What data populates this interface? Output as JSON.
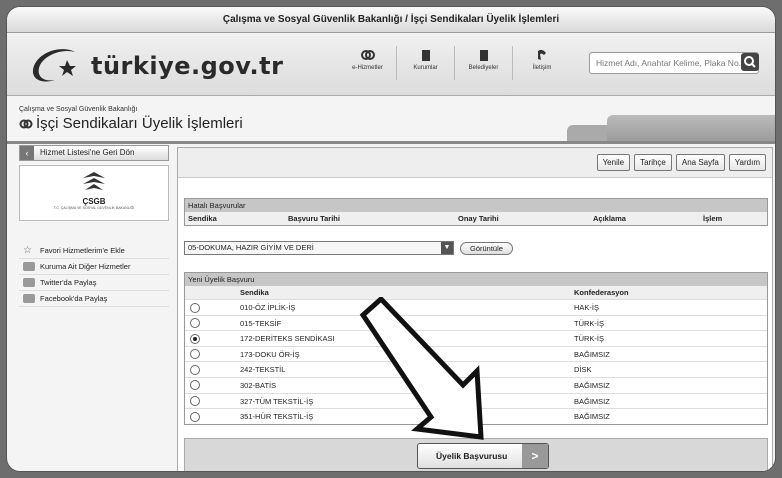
{
  "window": {
    "title": "Çalışma ve Sosyal Güvenlik Bakanlığı / İşçi Sendikaları Üyelik İşlemleri"
  },
  "header": {
    "logo_text": "türkiye.gov.tr",
    "nav": [
      {
        "label": "e-Hizmetler",
        "icon": "chain-link-icon"
      },
      {
        "label": "Kurumlar",
        "icon": "building-icon"
      },
      {
        "label": "Belediyeler",
        "icon": "municipality-icon"
      },
      {
        "label": "İletişim",
        "icon": "phone-icon"
      }
    ],
    "search_placeholder": "Hizmet Adı, Anahtar Kelime, Plaka No..."
  },
  "page": {
    "ministry": "Çalışma ve Sosyal Güvenlik Bakanlığı",
    "title": "İşçi Sendikaları Üyelik İşlemleri"
  },
  "sidebar": {
    "back_label": "Hizmet Listesi'ne Geri Dön",
    "org_abbr": "ÇSGB",
    "org_full": "T.C. ÇALIŞMA VE SOSYAL GÜVENLİK BAKANLIĞI",
    "links": [
      {
        "label": "Favori Hizmetlerim'e Ekle",
        "icon": "star-icon"
      },
      {
        "label": "Kuruma Ait Diğer Hizmetler",
        "icon": "list-icon"
      },
      {
        "label": "Twitter'da Paylaş",
        "icon": "twitter-icon"
      },
      {
        "label": "Facebook'da Paylaş",
        "icon": "facebook-icon"
      }
    ]
  },
  "toolbar": {
    "buttons": [
      "Yenile",
      "Tarihçe",
      "Ana Sayfa",
      "Yardım"
    ]
  },
  "hatali": {
    "title": "Hatalı Başvurular",
    "columns": [
      "Sendika",
      "Başvuru Tarihi",
      "Onay Tarihi",
      "Açıklama",
      "İşlem"
    ]
  },
  "filter": {
    "selected": "05-DOKUMA, HAZIR GİYİM VE DERİ",
    "button": "Görüntüle"
  },
  "yeni": {
    "title": "Yeni Üyelik Başvuru",
    "columns": [
      "",
      "Sendika",
      "Konfederasyon"
    ],
    "rows": [
      {
        "sendika": "010-ÖZ İPLİK-İŞ",
        "konf": "HAK-İŞ",
        "selected": false
      },
      {
        "sendika": "015-TEKSİF",
        "konf": "TÜRK-İŞ",
        "selected": false
      },
      {
        "sendika": "172-DERİTEKS SENDİKASI",
        "konf": "TÜRK-İŞ",
        "selected": true
      },
      {
        "sendika": "173-DOKU ÖR-İŞ",
        "konf": "BAĞIMSIZ",
        "selected": false
      },
      {
        "sendika": "242-TEKSTİL",
        "konf": "DİSK",
        "selected": false
      },
      {
        "sendika": "302-BATİS",
        "konf": "BAĞIMSIZ",
        "selected": false
      },
      {
        "sendika": "327-TÜM TEKSTİL-İŞ",
        "konf": "BAĞIMSIZ",
        "selected": false
      },
      {
        "sendika": "351-HÜR TEKSTİL-İŞ",
        "konf": "BAĞIMSIZ",
        "selected": false
      }
    ]
  },
  "submit": {
    "label": "Üyelik Başvurusu",
    "arrow": ">"
  }
}
